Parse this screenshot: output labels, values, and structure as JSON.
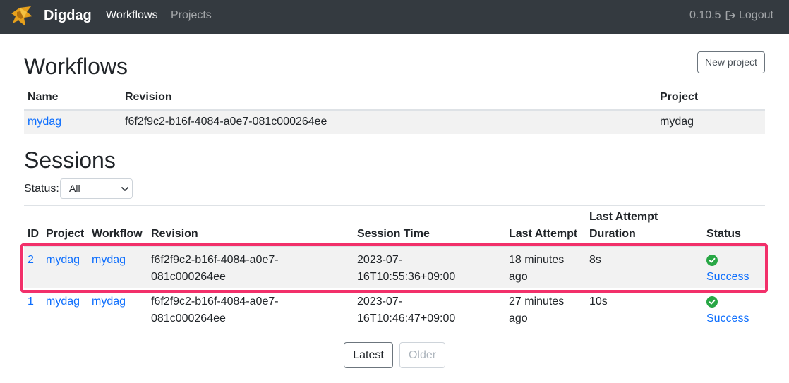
{
  "navbar": {
    "brand": "Digdag",
    "links": [
      {
        "label": "Workflows",
        "active": true
      },
      {
        "label": "Projects",
        "active": false
      }
    ],
    "version": "0.10.5",
    "logout_label": "Logout"
  },
  "workflows": {
    "title": "Workflows",
    "new_project_label": "New project",
    "columns": [
      "Name",
      "Revision",
      "Project"
    ],
    "rows": [
      {
        "name": "mydag",
        "revision": "f6f2f9c2-b16f-4084-a0e7-081c000264ee",
        "project": "mydag"
      }
    ]
  },
  "sessions": {
    "title": "Sessions",
    "status_filter": {
      "label": "Status:",
      "selected": "All"
    },
    "columns": {
      "id": "ID",
      "project": "Project",
      "workflow": "Workflow",
      "revision": "Revision",
      "session_time": "Session Time",
      "last_attempt": "Last Attempt",
      "duration_line1": "Last Attempt",
      "duration_line2": "Duration",
      "status": "Status"
    },
    "rows": [
      {
        "id": "2",
        "project": "mydag",
        "workflow": "mydag",
        "revision_line1": "f6f2f9c2-b16f-4084-a0e7-",
        "revision_line2": "081c000264ee",
        "session_time_line1": "2023-07-",
        "session_time_line2": "16T10:55:36+09:00",
        "last_attempt_line1": "18 minutes",
        "last_attempt_line2": "ago",
        "duration": "8s",
        "status": "Success"
      },
      {
        "id": "1",
        "project": "mydag",
        "workflow": "mydag",
        "revision_line1": "f6f2f9c2-b16f-4084-a0e7-",
        "revision_line2": "081c000264ee",
        "session_time_line1": "2023-07-",
        "session_time_line2": "16T10:46:47+09:00",
        "last_attempt_line1": "27 minutes",
        "last_attempt_line2": "ago",
        "duration": "10s",
        "status": "Success"
      }
    ],
    "pagination": {
      "latest_label": "Latest",
      "older_label": "Older"
    }
  },
  "colors": {
    "navbar_bg": "#343a40",
    "link": "#0d6efd",
    "success": "#28a745",
    "highlight": "#f2306a"
  }
}
